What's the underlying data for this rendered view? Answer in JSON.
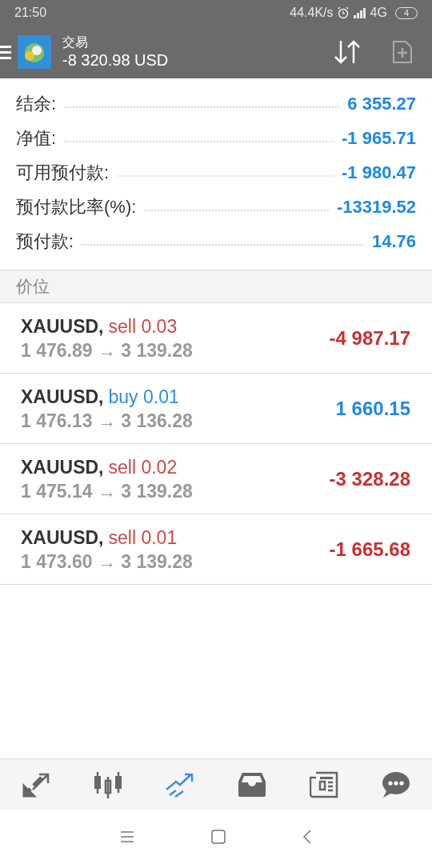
{
  "status_bar": {
    "time": "21:50",
    "speed": "44.4K/s",
    "network": "4G",
    "battery": "4"
  },
  "app_bar": {
    "title": "交易",
    "subtitle": "-8 320.98 USD"
  },
  "summary": [
    {
      "label": "结余:",
      "value": "6 355.27"
    },
    {
      "label": "净值:",
      "value": "-1 965.71"
    },
    {
      "label": "可用预付款:",
      "value": "-1 980.47"
    },
    {
      "label": "预付款比率(%):",
      "value": "-13319.52"
    },
    {
      "label": "预付款:",
      "value": "14.76"
    }
  ],
  "section_header": "价位",
  "positions": [
    {
      "symbol": "XAUUSD,",
      "kind": "sell",
      "order": "sell 0.03",
      "prices": "1 476.89 → 3 139.28",
      "profit": "-4 987.17"
    },
    {
      "symbol": "XAUUSD,",
      "kind": "buy",
      "order": "buy 0.01",
      "prices": "1 476.13 → 3 136.28",
      "profit": "1 660.15"
    },
    {
      "symbol": "XAUUSD,",
      "kind": "sell",
      "order": "sell 0.02",
      "prices": "1 475.14 → 3 139.28",
      "profit": "-3 328.28"
    },
    {
      "symbol": "XAUUSD,",
      "kind": "sell",
      "order": "sell 0.01",
      "prices": "1 473.60 → 3 139.28",
      "profit": "-1 665.68"
    }
  ],
  "bottom_nav": [
    {
      "kind": "quotes",
      "selected": false
    },
    {
      "kind": "chart",
      "selected": false
    },
    {
      "kind": "trade",
      "selected": true
    },
    {
      "kind": "inbox",
      "selected": false
    },
    {
      "kind": "news",
      "selected": false
    },
    {
      "kind": "chat",
      "selected": false
    }
  ]
}
